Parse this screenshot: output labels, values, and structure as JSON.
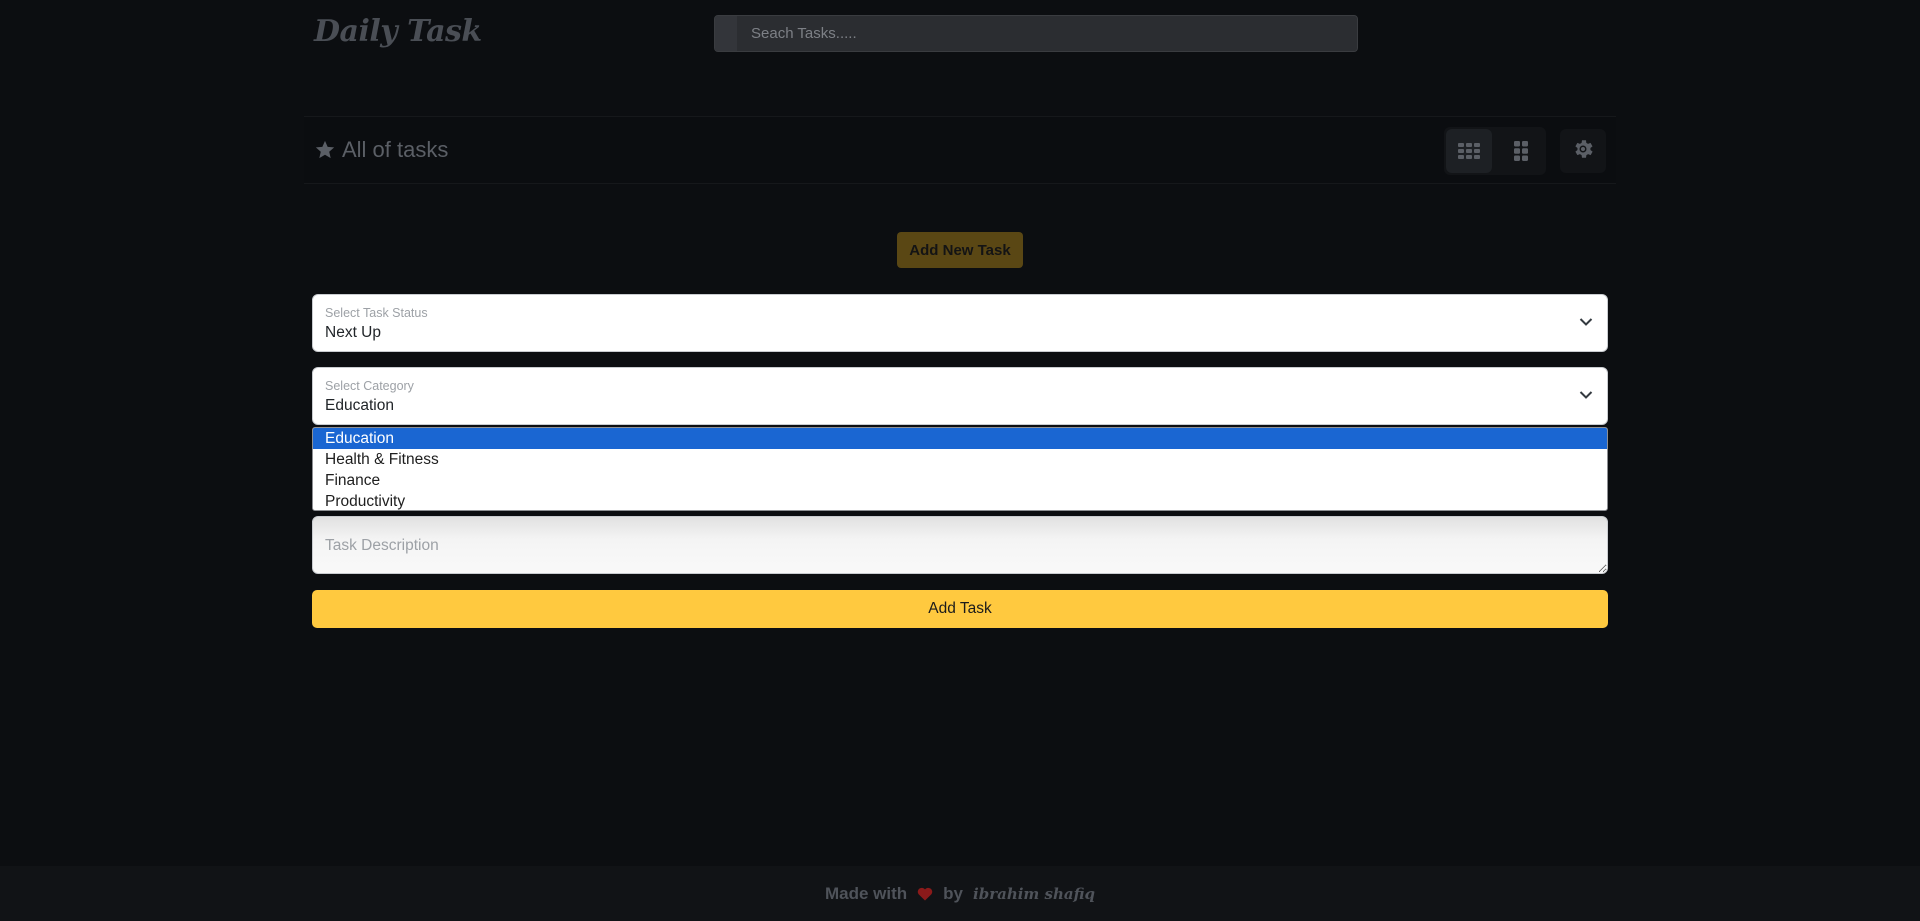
{
  "header": {
    "logo": "Daily Task",
    "search_placeholder": "Seach Tasks....."
  },
  "section": {
    "title": "All of tasks",
    "icons": [
      "star-icon",
      "grid-3x3-icon",
      "grid-2-icon",
      "gear-icon"
    ]
  },
  "form": {
    "add_new_label": "Add New Task",
    "status": {
      "label": "Select Task Status",
      "value": "Next Up"
    },
    "category": {
      "label": "Select Category",
      "value": "Education",
      "options": [
        "Education",
        "Health & Fitness",
        "Finance",
        "Productivity"
      ],
      "selected_index": 0
    },
    "description_placeholder": "Task Description",
    "submit_label": "Add Task"
  },
  "footer": {
    "made_with": "Made with",
    "by": "by",
    "author": "ibrahim shafiq"
  },
  "colors": {
    "background": "#0c0e11",
    "accent": "#ffc93f",
    "selected_option": "#1a66d2",
    "heart": "#8b1a1a"
  }
}
